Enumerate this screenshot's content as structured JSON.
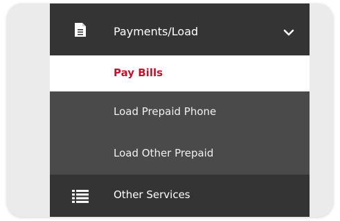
{
  "menu": {
    "items": [
      {
        "label": "Payments/Load",
        "icon": "document-icon",
        "expanded": true,
        "expand_icon": "chevron-down-icon",
        "children": [
          {
            "label": "Pay Bills",
            "active": true
          },
          {
            "label": "Load Prepaid Phone"
          },
          {
            "label": "Load Other Prepaid"
          }
        ]
      },
      {
        "label": "Other Services",
        "icon": "list-icon"
      }
    ]
  },
  "colors": {
    "parent_bg": "#343434",
    "submenu_bg": "#4a4a4a",
    "active_bg": "#ffffff",
    "active_text": "#c8102e",
    "text": "#ffffff"
  }
}
